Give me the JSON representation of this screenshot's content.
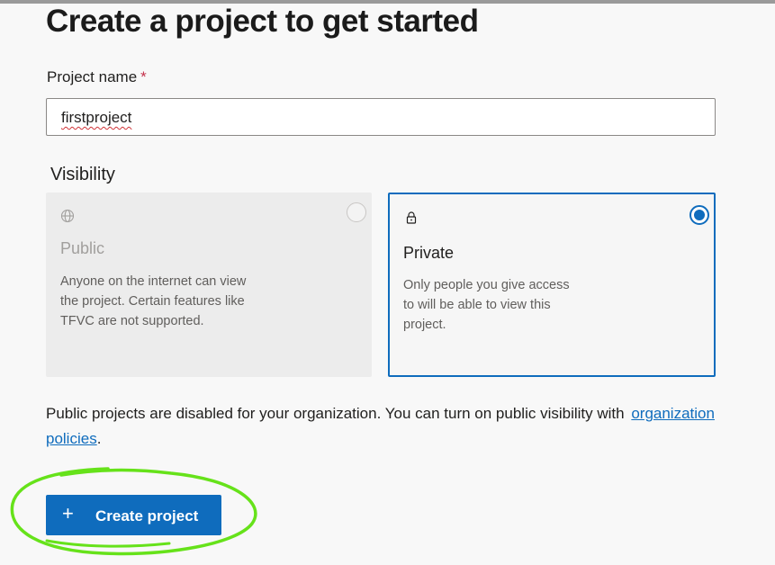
{
  "page": {
    "title": "Create a project to get started"
  },
  "form": {
    "project_name_label": "Project name",
    "required_marker": "*",
    "project_name_value": "firstproject",
    "visibility_label": "Visibility"
  },
  "visibility_options": [
    {
      "icon": "globe-icon",
      "title": "Public",
      "description": "Anyone on the internet can view the project. Certain features like TFVC are not supported.",
      "selected": false,
      "disabled": true
    },
    {
      "icon": "lock-icon",
      "title": "Private",
      "description": "Only people you give access to will be able to view this project.",
      "selected": true,
      "disabled": false
    }
  ],
  "notice": {
    "text": "Public projects are disabled for your organization. You can turn on public visibility with",
    "link_text": "organization policies",
    "trailing": "."
  },
  "actions": {
    "create_icon": "plus-icon",
    "create_label": "Create project"
  },
  "colors": {
    "accent": "#0f6cbd",
    "required": "#c4314b",
    "annotation": "#66e21a"
  }
}
